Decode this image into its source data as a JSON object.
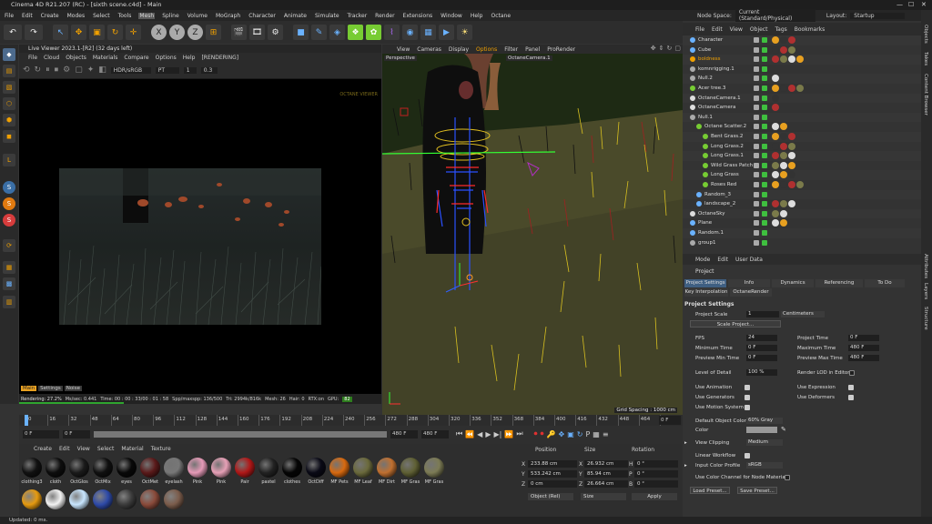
{
  "titlebar": {
    "title": "Cinema 4D R21.207 (RC) - [sixth scene.c4d] - Main"
  },
  "menubar": {
    "items": [
      "File",
      "Edit",
      "Create",
      "Modes",
      "Select",
      "Tools",
      "Mesh",
      "Spline",
      "Volume",
      "MoGraph",
      "Character",
      "Animate",
      "Simulate",
      "Tracker",
      "Render",
      "Extensions",
      "Window",
      "Help",
      "Octane"
    ],
    "active": "Mesh"
  },
  "nodespace": {
    "label": "Node Space:",
    "value": "Current (Standard/Physical)",
    "layout_label": "Layout:",
    "layout_value": "Startup"
  },
  "liveviewer": {
    "title": "Live Viewer 2023.1-[R2] (32 days left)",
    "menu": [
      "File",
      "Cloud",
      "Objects",
      "Materials",
      "Compare",
      "Options",
      "Help",
      "[RENDERING]"
    ],
    "colorspace": "HDR/sRGB",
    "pt": "PT",
    "val1": "1",
    "val2": "0.3",
    "watermark": "OCTANE VIEWER",
    "tabs": [
      "Main",
      "Settings",
      "Noise"
    ],
    "status": {
      "rendering": "Rendering: 27.2%",
      "ms": "Ms/sec: 0.441",
      "time": "Time: 00 : 00 : 33/00 : 01 : 58",
      "spp": "Spp/maxspp: 136/500",
      "tri": "Tri: 2994k/816k",
      "mesh": "Mesh: 26",
      "hair": "Hair: 0",
      "rtx": "RTX:on",
      "gpu": "GPU:",
      "gpu_temp": "82"
    }
  },
  "viewport": {
    "menu": [
      "View",
      "Cameras",
      "Display",
      "Options",
      "Filter",
      "Panel",
      "ProRender"
    ],
    "label": "Perspective",
    "camera": "OctaneCamera.1",
    "grid": "Grid Spacing : 1000 cm"
  },
  "timeline": {
    "ticks": [
      "0",
      "16",
      "32",
      "48",
      "64",
      "80",
      "96",
      "112",
      "128",
      "144",
      "160",
      "176",
      "192",
      "208",
      "224",
      "240",
      "256",
      "272",
      "288",
      "304",
      "320",
      "336",
      "352",
      "368",
      "384",
      "400",
      "416",
      "432",
      "448",
      "464",
      "480"
    ],
    "current": "0 F"
  },
  "transport": {
    "start": "0 F",
    "current": "0 F",
    "end": "480 F",
    "end2": "480 F"
  },
  "materials": {
    "menu": [
      "Create",
      "Edit",
      "View",
      "Select",
      "Material",
      "Texture"
    ],
    "items": [
      {
        "label": "clothing3",
        "color": "#111111"
      },
      {
        "label": "cloth",
        "color": "#0d0d0d"
      },
      {
        "label": "OctGlos",
        "color": "#1a1a1a"
      },
      {
        "label": "OctMix",
        "color": "#101010"
      },
      {
        "label": "eyes",
        "color": "#080808"
      },
      {
        "label": "OctMet",
        "color": "#5a1a1a"
      },
      {
        "label": "eyelash",
        "color": "#777777"
      },
      {
        "label": "Pink",
        "color": "#e59ab7"
      },
      {
        "label": "Pink",
        "color": "#e6a0b6"
      },
      {
        "label": "Pair",
        "color": "#b01818"
      },
      {
        "label": "pastel",
        "color": "#222222"
      },
      {
        "label": "clothes",
        "color": "#050505"
      },
      {
        "label": "OctDiff",
        "color": "#0a0a16"
      },
      {
        "label": "MF Pets",
        "color": "#d86a10"
      },
      {
        "label": "MF Leaf",
        "color": "#6b6a3c"
      },
      {
        "label": "MF Dirt",
        "color": "#c07030"
      },
      {
        "label": "MF Gras",
        "color": "#5f6034"
      },
      {
        "label": "MF Gras",
        "color": "#7c7b55"
      }
    ],
    "items2": [
      {
        "label": "",
        "color": "#e59a10"
      },
      {
        "label": "",
        "color": "#f2f2f2"
      },
      {
        "label": "",
        "color": "#c8e6ff"
      },
      {
        "label": "",
        "color": "#2e4aa8"
      },
      {
        "label": "",
        "color": "#3b3b3b"
      },
      {
        "label": "",
        "color": "#8a4a3a"
      },
      {
        "label": "",
        "color": "#7b5c4b"
      }
    ]
  },
  "coords": {
    "headers": [
      "Position",
      "Size",
      "Rotation"
    ],
    "x": "233.88 cm",
    "y": "533.242 cm",
    "z": "0 cm",
    "sx": "26.932 cm",
    "sy": "85.94 cm",
    "sz": "26.664 cm",
    "h": "0 °",
    "p": "0 °",
    "b": "0 °",
    "mode": "Object (Rel)",
    "size_mode": "Size",
    "apply": "Apply"
  },
  "status": {
    "text": "Updated: 0 ms."
  },
  "objectmanager": {
    "menu": [
      "File",
      "Edit",
      "View",
      "Object",
      "Tags",
      "Bookmarks"
    ],
    "objects": [
      {
        "name": "Character",
        "icon": "#6ab2ff",
        "indent": 0,
        "highlight": false
      },
      {
        "name": "Cube",
        "icon": "#6ab2ff",
        "indent": 0,
        "highlight": false
      },
      {
        "name": "boldness",
        "icon": "#f0a000",
        "indent": 0,
        "highlight": true
      },
      {
        "name": "komnrigging.1",
        "icon": "#aaa",
        "indent": 0,
        "highlight": false
      },
      {
        "name": "Null.2",
        "icon": "#aaa",
        "indent": 0,
        "highlight": false
      },
      {
        "name": "Acer tree.3",
        "icon": "#77cc33",
        "indent": 0,
        "highlight": false
      },
      {
        "name": "OctaneCamera.1",
        "icon": "#ddd",
        "indent": 0,
        "highlight": false
      },
      {
        "name": "OctaneCamera",
        "icon": "#ddd",
        "indent": 0,
        "highlight": false
      },
      {
        "name": "Null.1",
        "icon": "#aaa",
        "indent": 0,
        "highlight": false
      },
      {
        "name": "Octane Scatter.2",
        "icon": "#77cc33",
        "indent": 1,
        "highlight": false
      },
      {
        "name": "Bent Grass.2",
        "icon": "#77cc33",
        "indent": 2,
        "highlight": false
      },
      {
        "name": "Long Grass.2",
        "icon": "#77cc33",
        "indent": 2,
        "highlight": false
      },
      {
        "name": "Long Grass.1",
        "icon": "#77cc33",
        "indent": 2,
        "highlight": false
      },
      {
        "name": "Wild Grass Patch",
        "icon": "#77cc33",
        "indent": 2,
        "highlight": false
      },
      {
        "name": "Long Grass",
        "icon": "#77cc33",
        "indent": 2,
        "highlight": false
      },
      {
        "name": "Roses Red",
        "icon": "#77cc33",
        "indent": 2,
        "highlight": false
      },
      {
        "name": "Random_3",
        "icon": "#6ab2ff",
        "indent": 1,
        "highlight": false
      },
      {
        "name": "landscape_2",
        "icon": "#6ab2ff",
        "indent": 1,
        "highlight": false
      },
      {
        "name": "OctaneSky",
        "icon": "#ddd",
        "indent": 0,
        "highlight": false
      },
      {
        "name": "Plane",
        "icon": "#6ab2ff",
        "indent": 0,
        "highlight": false
      },
      {
        "name": "Random.1",
        "icon": "#6ab2ff",
        "indent": 0,
        "highlight": false
      },
      {
        "name": "group1",
        "icon": "#aaa",
        "indent": 0,
        "highlight": false
      }
    ]
  },
  "attributes": {
    "menu": [
      "Mode",
      "Edit",
      "User Data"
    ],
    "object": "Project",
    "tabs": [
      "Project Settings",
      "Info",
      "Dynamics",
      "Referencing",
      "To Do"
    ],
    "subtabs": [
      "Key Interpolation",
      "OctaneRender"
    ],
    "section": "Project Settings",
    "project_scale_label": "Project Scale",
    "project_scale": "1",
    "scale_unit": "Centimeters",
    "scale_project": "Scale Project...",
    "fps_label": "FPS",
    "fps": "24",
    "project_time_label": "Project Time",
    "project_time": "0 F",
    "min_time_label": "Minimum Time",
    "min_time": "0 F",
    "max_time_label": "Maximum Time",
    "max_time": "480 F",
    "prev_min_label": "Preview Min Time",
    "prev_min": "0 F",
    "prev_max_label": "Preview Max Time",
    "prev_max": "480 F",
    "lod_label": "Level of Detail",
    "lod": "100 %",
    "render_lod_label": "Render LOD in Editor",
    "use_animation": "Use Animation",
    "use_expression": "Use Expression",
    "use_generators": "Use Generators",
    "use_deformers": "Use Deformers",
    "use_motion": "Use Motion System",
    "default_color_label": "Default Object Color",
    "default_color": "60% Gray",
    "color_label": "Color",
    "view_clipping_label": "View Clipping",
    "view_clipping": "Medium",
    "linear_label": "Linear Workflow",
    "input_profile_label": "Input Color Profile",
    "input_profile": "sRGB",
    "color_channel_label": "Use Color Channel for Node Material",
    "load_preset": "Load Preset...",
    "save_preset": "Save Preset..."
  },
  "rightstrip": {
    "items": [
      "Objects",
      "Takes",
      "Content Browser",
      "Attributes",
      "Layers",
      "Structure"
    ]
  }
}
